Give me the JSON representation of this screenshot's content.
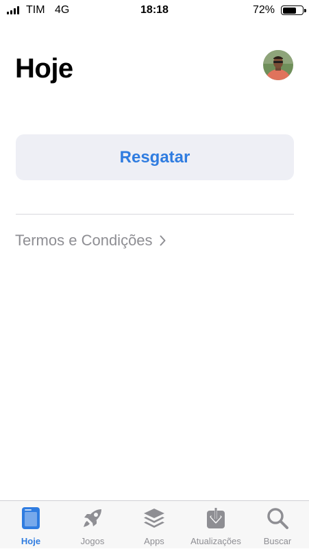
{
  "status_bar": {
    "carrier": "TIM",
    "network": "4G",
    "time": "18:18",
    "battery_percent": "72%",
    "battery_level": 0.72
  },
  "header": {
    "title": "Hoje"
  },
  "redeem": {
    "label": "Resgatar"
  },
  "terms": {
    "label": "Termos e Condições"
  },
  "tab_bar": {
    "active": "hoje",
    "tabs": [
      {
        "label": "Hoje",
        "icon": "today-icon"
      },
      {
        "label": "Jogos",
        "icon": "rocket-icon"
      },
      {
        "label": "Apps",
        "icon": "layers-icon"
      },
      {
        "label": "Atualizações",
        "icon": "download-icon"
      },
      {
        "label": "Buscar",
        "icon": "search-icon"
      }
    ]
  },
  "colors": {
    "accent": "#2f7ce0",
    "secondary_text": "#8e8e93",
    "button_bg": "#eeeff5",
    "tab_inactive": "#8e8e93"
  }
}
